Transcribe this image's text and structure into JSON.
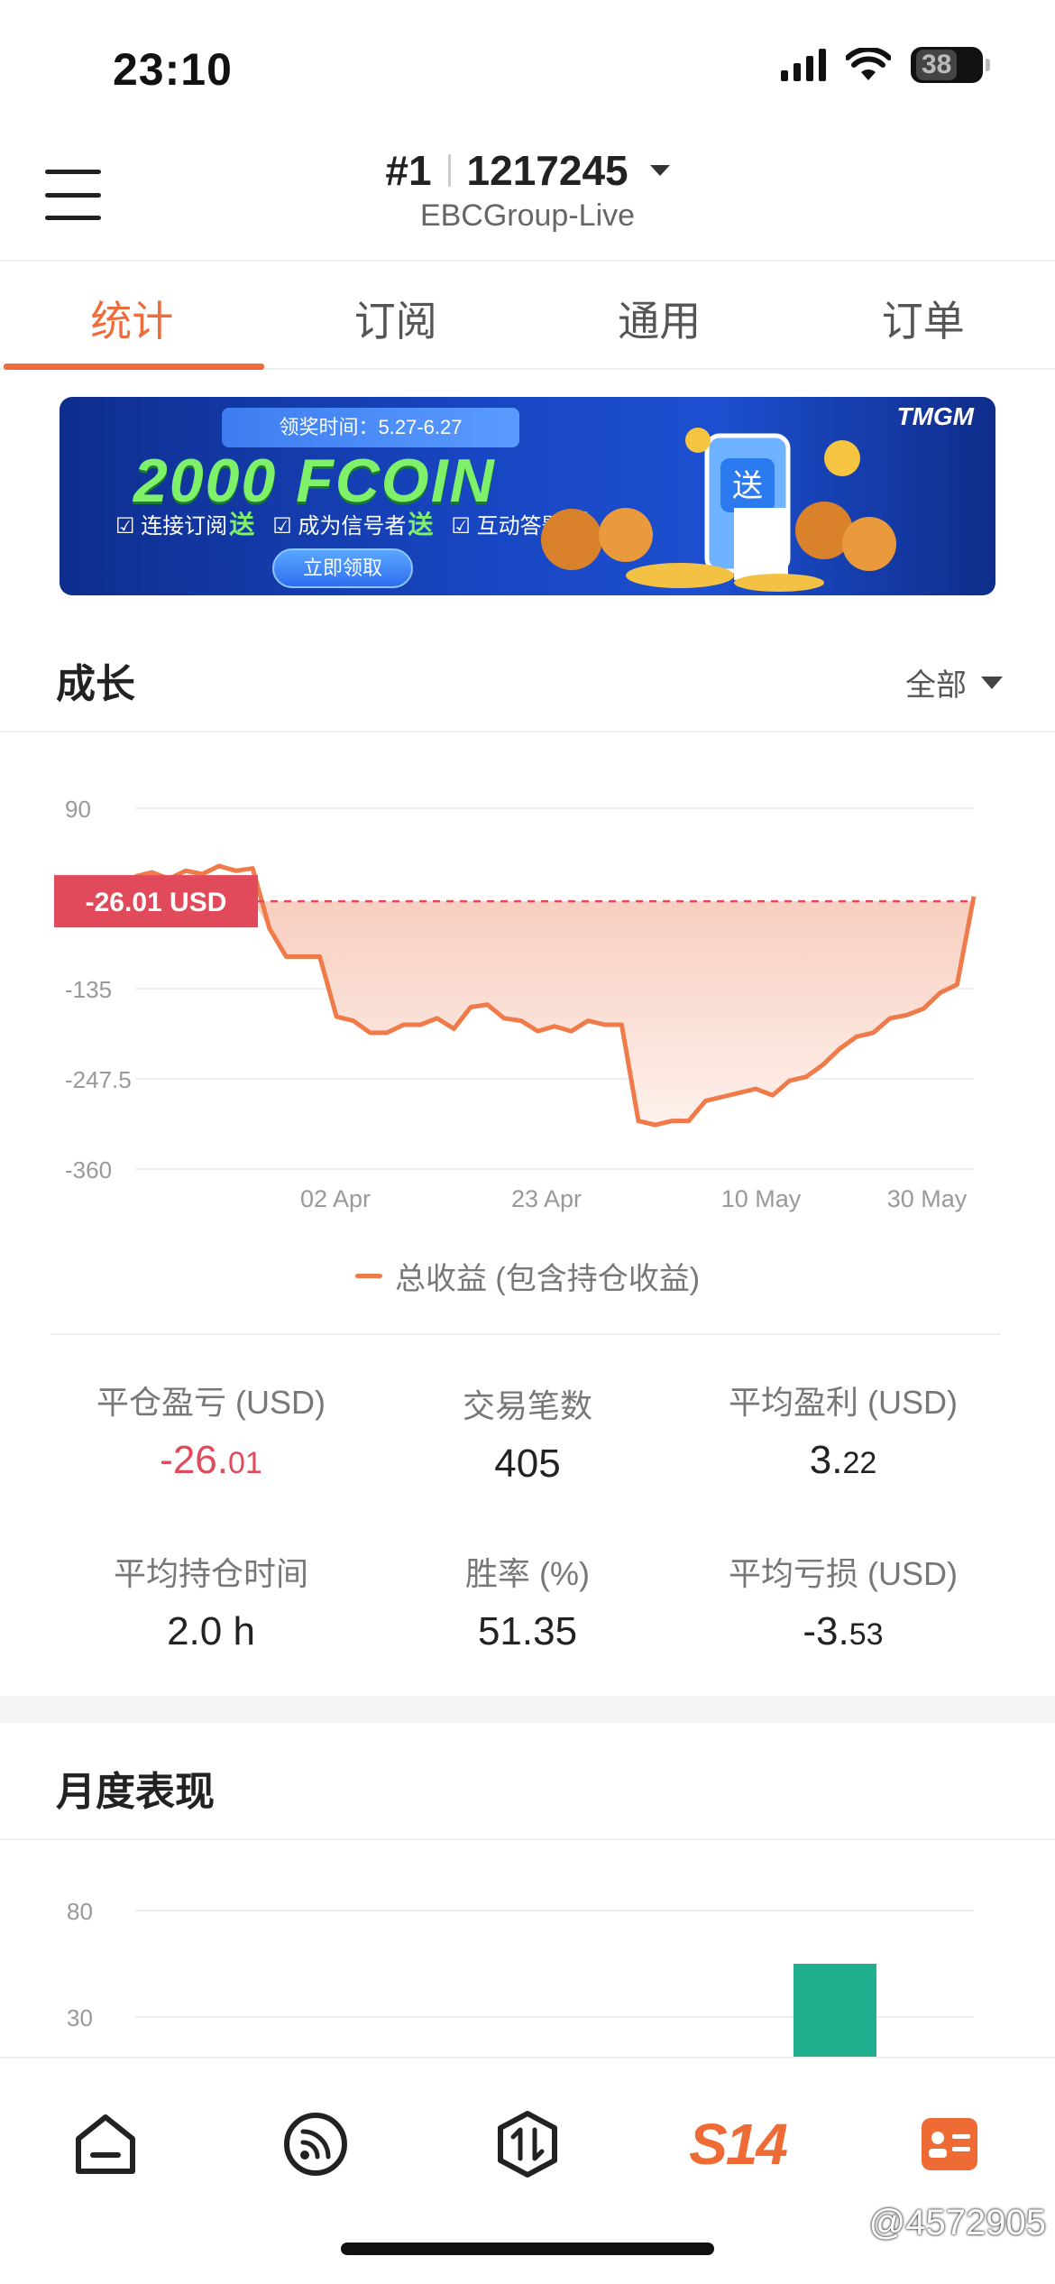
{
  "status_bar": {
    "time": "23:10",
    "battery": "38"
  },
  "header": {
    "account_rank": "#1",
    "account_id": "1217245",
    "server": "EBCGroup-Live"
  },
  "tabs": [
    {
      "label": "统计",
      "active": true
    },
    {
      "label": "订阅",
      "active": false
    },
    {
      "label": "通用",
      "active": false
    },
    {
      "label": "订单",
      "active": false
    }
  ],
  "banner": {
    "period": "领奖时间：5.27-6.27",
    "title": "2000 FCOIN",
    "features": [
      "连接订阅",
      "成为信号者",
      "互动答题"
    ],
    "gift_word": "送",
    "cta": "立即领取",
    "brand": "TMGM",
    "accent": "#7ef06a"
  },
  "growth": {
    "title": "成长",
    "range": "全部",
    "current_label": "-26.01 USD",
    "legend": "总收益 (包含持仓收益)",
    "line_color": "#ef7b4a",
    "badge_color": "#e04a5a"
  },
  "chart_data": [
    {
      "type": "area",
      "ylim": [
        -360,
        90
      ],
      "y_ticks": [
        "90",
        "-135",
        "-247.5",
        "-360"
      ],
      "x_ticks": [
        "02 Apr",
        "23 Apr",
        "10 May",
        "30 May"
      ],
      "reference_line": -26.01,
      "series": [
        {
          "name": "总收益 (包含持仓收益)",
          "x": [
            0,
            1,
            2,
            3,
            4,
            5,
            6,
            7,
            8,
            9,
            10,
            11,
            12,
            13,
            14,
            15,
            16,
            17,
            18,
            19,
            20,
            21,
            22,
            23,
            24,
            25,
            26,
            27,
            28,
            29,
            30,
            31,
            32,
            33,
            34,
            35,
            36,
            37,
            38,
            39,
            40,
            41,
            42,
            43,
            44,
            45,
            46,
            47,
            48,
            49,
            50
          ],
          "values": [
            5,
            10,
            2,
            12,
            8,
            18,
            12,
            15,
            -60,
            -95,
            -95,
            -95,
            -170,
            -175,
            -190,
            -190,
            -180,
            -180,
            -172,
            -185,
            -158,
            -155,
            -172,
            -175,
            -188,
            -182,
            -188,
            -175,
            -180,
            -180,
            -300,
            -305,
            -300,
            -300,
            -275,
            -270,
            -265,
            -260,
            -268,
            -250,
            -245,
            -230,
            -210,
            -195,
            -190,
            -172,
            -168,
            -160,
            -140,
            -130,
            -20
          ]
        }
      ]
    },
    {
      "type": "bar",
      "y_ticks": [
        "80",
        "30"
      ],
      "series": [
        {
          "values": [
            55
          ]
        }
      ],
      "color": "#1fae8e"
    }
  ],
  "stats": [
    {
      "label": "平仓盈亏 (USD)",
      "value_main": "-26.",
      "value_small": "01",
      "negative": true
    },
    {
      "label": "交易笔数",
      "value_main": "405",
      "value_small": "",
      "negative": false
    },
    {
      "label": "平均盈利 (USD)",
      "value_main": "3.",
      "value_small": "22",
      "negative": false
    },
    {
      "label": "平均持仓时间",
      "value_main": "2.0 h",
      "value_small": "",
      "negative": false
    },
    {
      "label": "胜率 (%)",
      "value_main": "51.35",
      "value_small": "",
      "negative": false
    },
    {
      "label": "平均亏损 (USD)",
      "value_main": "-3.",
      "value_small": "53",
      "negative": false
    }
  ],
  "monthly": {
    "title": "月度表现"
  },
  "bottom_nav": [
    {
      "icon": "home-icon"
    },
    {
      "icon": "feed-icon"
    },
    {
      "icon": "trade-icon"
    },
    {
      "icon": "s14-icon",
      "label": "S14"
    },
    {
      "icon": "profile-card-icon"
    }
  ],
  "watermark": "@4572905",
  "accent_color": "#ee6b3b"
}
